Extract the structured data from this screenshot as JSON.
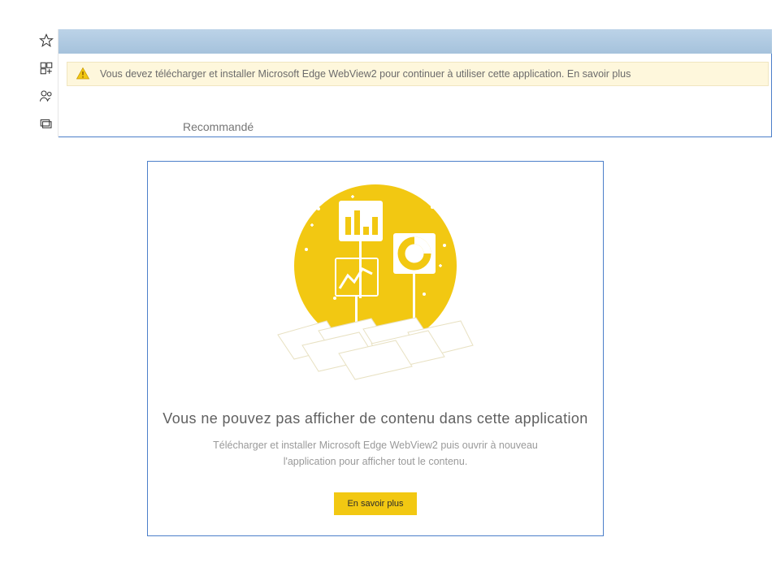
{
  "notice": {
    "text": "Vous devez télécharger et installer Microsoft Edge WebView2 pour continuer à utiliser cette application. En savoir plus"
  },
  "tab": {
    "label": "Recommandé"
  },
  "empty_state": {
    "headline": "Vous ne pouvez pas afficher de contenu dans cette application",
    "subtext_line1": "Télécharger et installer Microsoft Edge WebView2 puis ouvrir à nouveau",
    "subtext_line2": "l'application pour afficher tout le contenu.",
    "button_label": "En savoir plus"
  }
}
